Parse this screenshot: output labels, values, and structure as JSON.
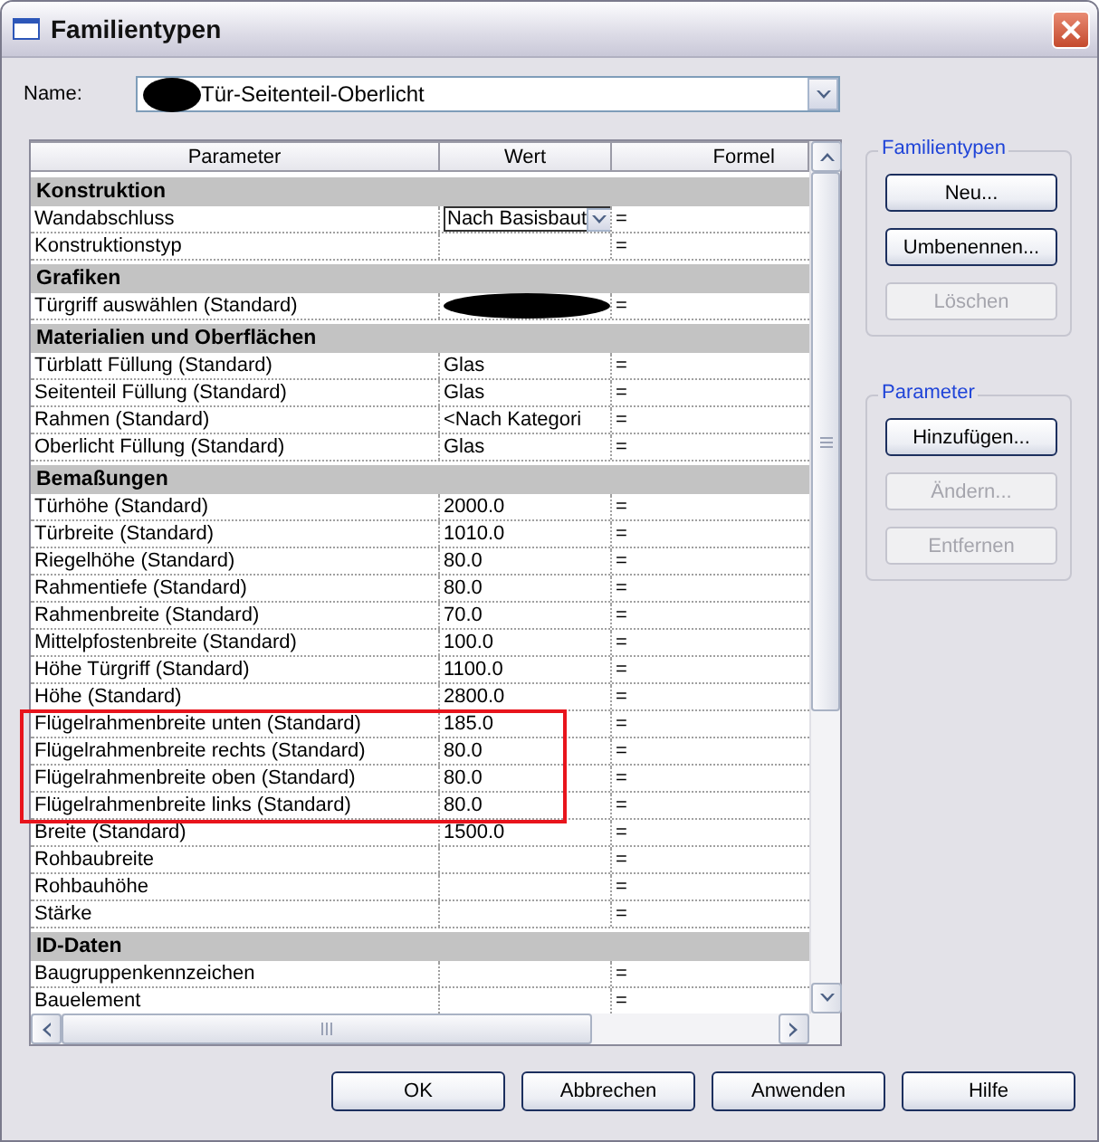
{
  "window": {
    "title": "Familientypen"
  },
  "name_field": {
    "label": "Name:",
    "value": "Tür-Seitenteil-Oberlicht",
    "redacted": true
  },
  "table": {
    "columns": [
      "Parameter",
      "Wert",
      "Formel"
    ],
    "rows": [
      {
        "kind": "group",
        "label": "Konstruktion"
      },
      {
        "kind": "param",
        "parameter": "Wandabschluss",
        "value": {
          "kind": "dropdown",
          "text": "Nach Basisbaut"
        },
        "formula": "=",
        "marked": false
      },
      {
        "kind": "param",
        "parameter": "Konstruktionstyp",
        "value": {
          "kind": "empty"
        },
        "formula": "=",
        "marked": false
      },
      {
        "kind": "group",
        "label": "Grafiken"
      },
      {
        "kind": "param",
        "parameter": "Türgriff auswählen (Standard)",
        "value": {
          "kind": "redacted"
        },
        "formula": "=",
        "marked": false
      },
      {
        "kind": "group",
        "label": "Materialien und Oberflächen"
      },
      {
        "kind": "param",
        "parameter": "Türblatt Füllung (Standard)",
        "value": {
          "kind": "text",
          "text": "Glas"
        },
        "formula": "=",
        "marked": false
      },
      {
        "kind": "param",
        "parameter": "Seitenteil Füllung (Standard)",
        "value": {
          "kind": "text",
          "text": "Glas"
        },
        "formula": "=",
        "marked": false
      },
      {
        "kind": "param",
        "parameter": "Rahmen (Standard)",
        "value": {
          "kind": "text",
          "text": "<Nach Kategori"
        },
        "formula": "=",
        "marked": false
      },
      {
        "kind": "param",
        "parameter": "Oberlicht Füllung (Standard)",
        "value": {
          "kind": "text",
          "text": "Glas"
        },
        "formula": "=",
        "marked": false
      },
      {
        "kind": "group",
        "label": "Bemaßungen"
      },
      {
        "kind": "param",
        "parameter": "Türhöhe (Standard)",
        "value": {
          "kind": "text",
          "text": "2000.0"
        },
        "formula": "=",
        "marked": false
      },
      {
        "kind": "param",
        "parameter": "Türbreite (Standard)",
        "value": {
          "kind": "text",
          "text": "1010.0"
        },
        "formula": "=",
        "marked": false
      },
      {
        "kind": "param",
        "parameter": "Riegelhöhe (Standard)",
        "value": {
          "kind": "text",
          "text": "80.0"
        },
        "formula": "=",
        "marked": false
      },
      {
        "kind": "param",
        "parameter": "Rahmentiefe (Standard)",
        "value": {
          "kind": "text",
          "text": "80.0"
        },
        "formula": "=",
        "marked": false
      },
      {
        "kind": "param",
        "parameter": "Rahmenbreite (Standard)",
        "value": {
          "kind": "text",
          "text": "70.0"
        },
        "formula": "=",
        "marked": false
      },
      {
        "kind": "param",
        "parameter": "Mittelpfostenbreite (Standard)",
        "value": {
          "kind": "text",
          "text": "100.0"
        },
        "formula": "=",
        "marked": false
      },
      {
        "kind": "param",
        "parameter": "Höhe Türgriff (Standard)",
        "value": {
          "kind": "text",
          "text": "1100.0"
        },
        "formula": "=",
        "marked": false
      },
      {
        "kind": "param",
        "parameter": "Höhe (Standard)",
        "value": {
          "kind": "text",
          "text": "2800.0"
        },
        "formula": "=",
        "marked": false
      },
      {
        "kind": "param",
        "parameter": "Flügelrahmenbreite unten (Standard)",
        "value": {
          "kind": "text",
          "text": "185.0"
        },
        "formula": "=",
        "marked": true
      },
      {
        "kind": "param",
        "parameter": "Flügelrahmenbreite rechts (Standard)",
        "value": {
          "kind": "text",
          "text": "80.0"
        },
        "formula": "=",
        "marked": true
      },
      {
        "kind": "param",
        "parameter": "Flügelrahmenbreite oben (Standard)",
        "value": {
          "kind": "text",
          "text": "80.0"
        },
        "formula": "=",
        "marked": true
      },
      {
        "kind": "param",
        "parameter": "Flügelrahmenbreite links (Standard)",
        "value": {
          "kind": "text",
          "text": "80.0"
        },
        "formula": "=",
        "marked": true
      },
      {
        "kind": "param",
        "parameter": "Breite (Standard)",
        "value": {
          "kind": "text",
          "text": "1500.0"
        },
        "formula": "=",
        "marked": false
      },
      {
        "kind": "param",
        "parameter": "Rohbaubreite",
        "value": {
          "kind": "empty"
        },
        "formula": "=",
        "marked": false
      },
      {
        "kind": "param",
        "parameter": "Rohbauhöhe",
        "value": {
          "kind": "empty"
        },
        "formula": "=",
        "marked": false
      },
      {
        "kind": "param",
        "parameter": "Stärke",
        "value": {
          "kind": "empty"
        },
        "formula": "=",
        "marked": false
      },
      {
        "kind": "group",
        "label": "ID-Daten"
      },
      {
        "kind": "param",
        "parameter": "Baugruppenkennzeichen",
        "value": {
          "kind": "empty"
        },
        "formula": "=",
        "marked": false
      },
      {
        "kind": "param",
        "parameter": "Bauelement",
        "value": {
          "kind": "empty"
        },
        "formula": "=",
        "marked": false
      }
    ]
  },
  "side_groups": [
    {
      "title": "Familientypen",
      "buttons": [
        {
          "label": "Neu...",
          "disabled": false
        },
        {
          "label": "Umbenennen...",
          "disabled": false
        },
        {
          "label": "Löschen",
          "disabled": true
        }
      ]
    },
    {
      "title": "Parameter",
      "buttons": [
        {
          "label": "Hinzufügen...",
          "disabled": false
        },
        {
          "label": "Ändern...",
          "disabled": true
        },
        {
          "label": "Entfernen",
          "disabled": true
        }
      ]
    }
  ],
  "buttons": [
    {
      "label": "OK"
    },
    {
      "label": "Abbrechen"
    },
    {
      "label": "Anwenden"
    },
    {
      "label": "Hilfe"
    }
  ]
}
